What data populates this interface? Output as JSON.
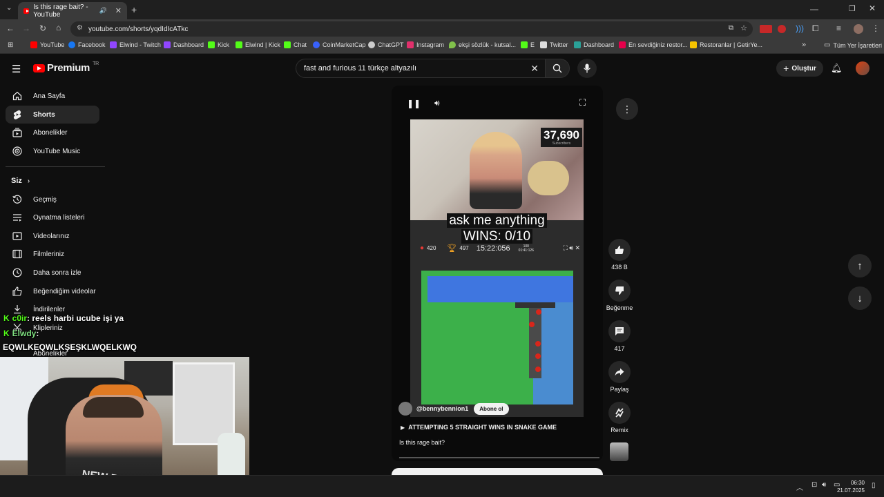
{
  "browser": {
    "tab_title": "Is this rage bait? - YouTube",
    "url": "youtube.com/shorts/yqdIdIcATkc",
    "bookmarks": [
      {
        "label": "YouTube",
        "color": "#ff0000"
      },
      {
        "label": "Facebook",
        "color": "#1877f2"
      },
      {
        "label": "Elwind - Twitch",
        "color": "#9146ff"
      },
      {
        "label": "Dashboard",
        "color": "#9146ff"
      },
      {
        "label": "Kick",
        "color": "#53fc18"
      },
      {
        "label": "Elwind | Kick",
        "color": "#53fc18"
      },
      {
        "label": "Chat",
        "color": "#53fc18"
      },
      {
        "label": "CoinMarketCap",
        "color": "#3861fb"
      },
      {
        "label": "ChatGPT",
        "color": "#cccccc"
      },
      {
        "label": "Instagram",
        "color": "#e1306c"
      },
      {
        "label": "ekşi sözlük - kutsal...",
        "color": "#81c14b"
      },
      {
        "label": "E",
        "color": "#53fc18"
      },
      {
        "label": "Twitter",
        "color": "#dddddd"
      },
      {
        "label": "Dashboard",
        "color": "#2aa198"
      },
      {
        "label": "En sevdiğiniz restor...",
        "color": "#e5004b"
      },
      {
        "label": "Restoranlar | GetirYe...",
        "color": "#f7c400"
      }
    ],
    "all_bookmarks": "Tüm Yer İşaretleri"
  },
  "header": {
    "logo": "Premium",
    "logo_region": "TR",
    "search_value": "fast and furious 11 türkçe altyazılı",
    "create_label": "Oluştur"
  },
  "sidebar": {
    "main": [
      {
        "label": "Ana Sayfa",
        "icon": "home-icon"
      },
      {
        "label": "Shorts",
        "icon": "shorts-icon"
      },
      {
        "label": "Abonelikler",
        "icon": "subscriptions-icon"
      },
      {
        "label": "YouTube Music",
        "icon": "music-icon"
      }
    ],
    "you_heading": "Siz",
    "you": [
      {
        "label": "Geçmiş",
        "icon": "history-icon"
      },
      {
        "label": "Oynatma listeleri",
        "icon": "playlist-icon"
      },
      {
        "label": "Videolarınız",
        "icon": "your-videos-icon"
      },
      {
        "label": "Filmleriniz",
        "icon": "movies-icon"
      },
      {
        "label": "Daha sonra izle",
        "icon": "watch-later-icon"
      },
      {
        "label": "Beğendiğim videolar",
        "icon": "liked-icon"
      },
      {
        "label": "İndirilenler",
        "icon": "download-icon"
      },
      {
        "label": "Klipleriniz",
        "icon": "clips-icon"
      },
      {
        "label": "Abonelikler",
        "icon": "subscriptions-icon"
      }
    ]
  },
  "short": {
    "sub_count": "37,690",
    "sub_count_caption": "Subscribers",
    "caption_line1": "ask me anything",
    "caption_line2": "WINS: 0/10",
    "game_apples": "420",
    "game_trophy": "497",
    "game_time": "15:22:056",
    "game_small": "100",
    "game_small2": "01:41:126",
    "channel": "@bennybennion1",
    "subscribe": "Abone ol",
    "title": "ATTEMPTING 5 STRAIGHT WINS IN SNAKE GAME",
    "description": "Is this rage bait?"
  },
  "actions": {
    "likes": "438 B",
    "dislike": "Beğenme",
    "comments": "417",
    "share": "Paylaş",
    "remix": "Remix"
  },
  "overlay": {
    "chat": [
      {
        "user": "c0ir",
        "message": ": reels harbi ucube işi ya"
      },
      {
        "user": "Elwdy",
        "message": ":"
      }
    ],
    "chat_line3": "EQWLKEQWLKŞEŞKLWQELKWQ",
    "webcam_shirt": "NEW BALANCE"
  },
  "taskbar": {
    "time": "06:30",
    "date": "21.07.2025"
  }
}
